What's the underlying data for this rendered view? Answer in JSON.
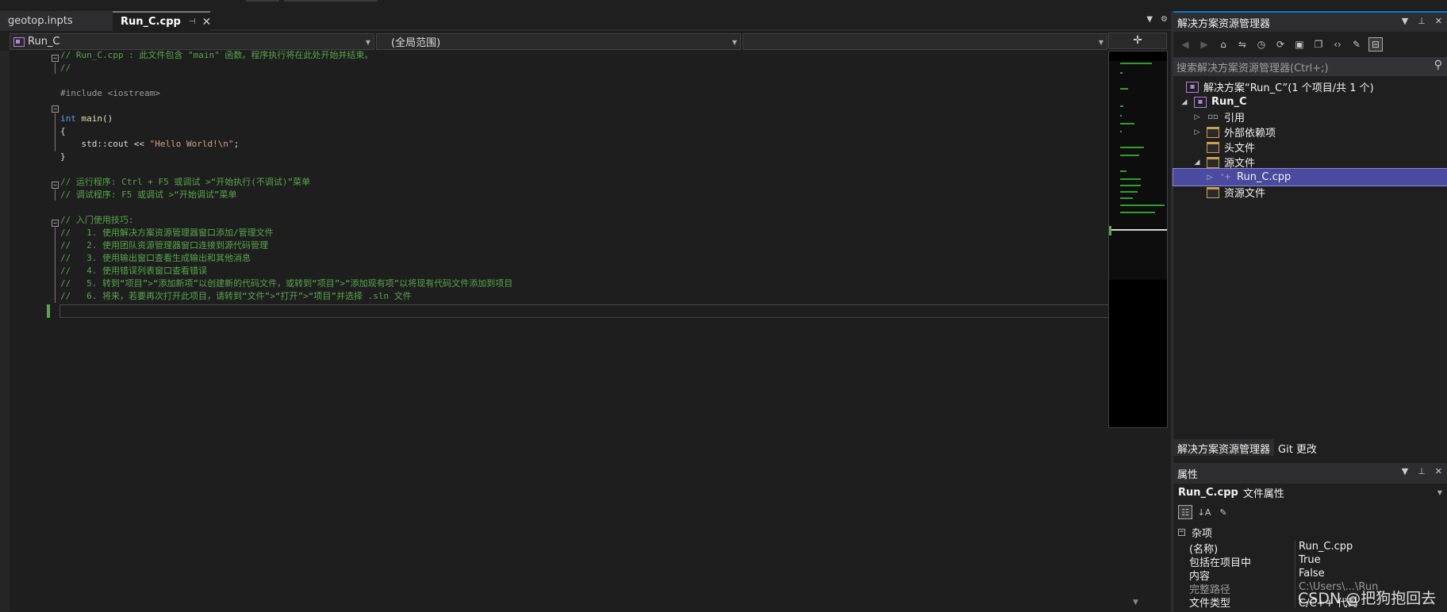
{
  "editor_tabs": [
    {
      "label": "geotop.inpts",
      "active": false
    },
    {
      "label": "Run_C.cpp",
      "active": true
    }
  ],
  "nav": {
    "project": "Run_C",
    "scope": "(全局范围)",
    "member": ""
  },
  "code": {
    "lines": [
      {
        "row": 1,
        "parts": [
          {
            "t": "// Run_C.cpp : 此文件包含 \"main\" 函数。程序执行将在此处开始并结束。",
            "c": "c-comment"
          }
        ]
      },
      {
        "row": 2,
        "parts": [
          {
            "t": "//",
            "c": "c-comment"
          }
        ]
      },
      {
        "row": 4,
        "parts": [
          {
            "t": "#include <iostream>",
            "c": "c-pre"
          }
        ]
      },
      {
        "row": 6,
        "parts": [
          {
            "t": "int ",
            "c": "c-kw"
          },
          {
            "t": "main",
            "c": "c-fn"
          },
          {
            "t": "()",
            "c": "c-plain"
          }
        ]
      },
      {
        "row": 7,
        "parts": [
          {
            "t": "{",
            "c": "c-plain"
          }
        ]
      },
      {
        "row": 8,
        "parts": [
          {
            "t": "    std::cout << ",
            "c": "c-plain"
          },
          {
            "t": "\"Hello World!\\n\"",
            "c": "c-str"
          },
          {
            "t": ";",
            "c": "c-plain"
          }
        ]
      },
      {
        "row": 9,
        "parts": [
          {
            "t": "}",
            "c": "c-plain"
          }
        ]
      },
      {
        "row": 11,
        "parts": [
          {
            "t": "// 运行程序: Ctrl + F5 或调试 >“开始执行(不调试)”菜单",
            "c": "c-comment"
          }
        ]
      },
      {
        "row": 12,
        "parts": [
          {
            "t": "// 调试程序: F5 或调试 >“开始调试”菜单",
            "c": "c-comment"
          }
        ]
      },
      {
        "row": 14,
        "parts": [
          {
            "t": "// 入门使用技巧:",
            "c": "c-comment"
          }
        ]
      },
      {
        "row": 15,
        "parts": [
          {
            "t": "//   1. 使用解决方案资源管理器窗口添加/管理文件",
            "c": "c-comment"
          }
        ]
      },
      {
        "row": 16,
        "parts": [
          {
            "t": "//   2. 使用团队资源管理器窗口连接到源代码管理",
            "c": "c-comment"
          }
        ]
      },
      {
        "row": 17,
        "parts": [
          {
            "t": "//   3. 使用输出窗口查看生成输出和其他消息",
            "c": "c-comment"
          }
        ]
      },
      {
        "row": 18,
        "parts": [
          {
            "t": "//   4. 使用错误列表窗口查看错误",
            "c": "c-comment"
          }
        ]
      },
      {
        "row": 19,
        "parts": [
          {
            "t": "//   5. 转到“项目”>“添加新项”以创建新的代码文件，或转到“项目”>“添加现有项”以将现有代码文件添加到项目",
            "c": "c-comment"
          }
        ]
      },
      {
        "row": 20,
        "parts": [
          {
            "t": "//   6. 将来，若要再次打开此项目，请转到“文件”>“打开”>“项目”并选择 .sln 文件",
            "c": "c-comment"
          }
        ]
      }
    ]
  },
  "solution_explorer": {
    "title": "解决方案资源管理器",
    "search_placeholder": "搜索解决方案资源管理器(Ctrl+;)",
    "solution_label": "解决方案“Run_C”(1 个项目/共 1 个)",
    "project_label": "Run_C",
    "items": {
      "references": "引用",
      "external_deps": "外部依赖项",
      "header_files": "头文件",
      "source_files": "源文件",
      "run_c_cpp": "Run_C.cpp",
      "resource_files": "资源文件"
    },
    "bottom_tabs": [
      "解决方案资源管理器",
      "Git 更改"
    ]
  },
  "properties": {
    "title": "属性",
    "object_name": "Run_C.cpp",
    "object_type": "文件属性",
    "category": "杂项",
    "rows": [
      {
        "k": "(名称)",
        "v": "Run_C.cpp"
      },
      {
        "k": "包括在项目中",
        "v": "True"
      },
      {
        "k": "内容",
        "v": "False"
      },
      {
        "k": "完整路径",
        "v": "C:\\Users\\...\\Run_"
      },
      {
        "k": "文件类型",
        "v": "C/C++ 代码"
      }
    ]
  },
  "watermark": "CSDN @把狗抱回去",
  "colors": {
    "accent": "#007acc",
    "selection": "#4a4a9e",
    "comment": "#57a64a",
    "keyword": "#569cd6"
  }
}
